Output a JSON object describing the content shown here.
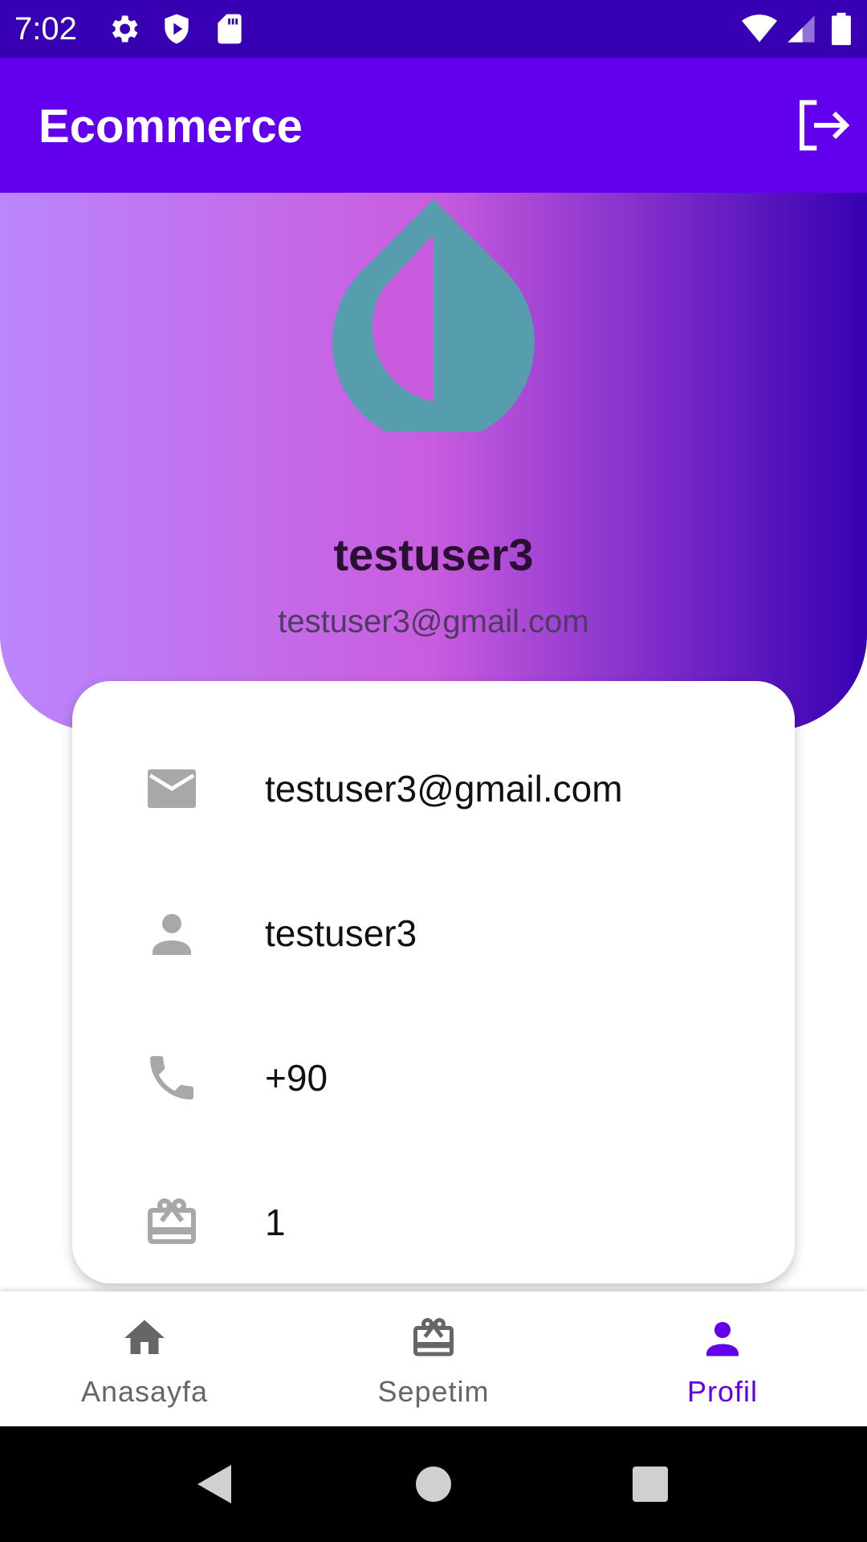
{
  "status_bar": {
    "time": "7:02",
    "icons": [
      "settings-icon",
      "shield-play-icon",
      "sd-card-icon",
      "wifi-icon",
      "signal-icon",
      "battery-icon"
    ]
  },
  "app_bar": {
    "title": "Ecommerce",
    "logout_icon": "logout-icon"
  },
  "profile_header": {
    "logo_icon": "droplet-logo-icon",
    "username": "testuser3",
    "email": "testuser3@gmail.com",
    "gradient_colors": [
      "#bb86fc",
      "#c95cdf",
      "#3700b3"
    ]
  },
  "info_card": {
    "rows": [
      {
        "icon": "email-icon",
        "value": "testuser3@gmail.com"
      },
      {
        "icon": "person-icon",
        "value": "testuser3"
      },
      {
        "icon": "phone-icon",
        "value": "+90"
      },
      {
        "icon": "gift-card-icon",
        "value": "1"
      }
    ]
  },
  "bottom_nav": {
    "items": [
      {
        "label": "Anasayfa",
        "icon": "home-icon",
        "active": false
      },
      {
        "label": "Sepetim",
        "icon": "gift-card-icon",
        "active": false
      },
      {
        "label": "Profil",
        "icon": "person-icon",
        "active": true
      }
    ],
    "active_color": "#6200ee",
    "inactive_color": "#666666"
  },
  "system_nav": {
    "buttons": [
      "back-icon",
      "home-circle-icon",
      "recents-icon"
    ]
  },
  "colors": {
    "status_bar": "#3700b3",
    "app_bar": "#6200ee",
    "logo": "#569dae"
  }
}
